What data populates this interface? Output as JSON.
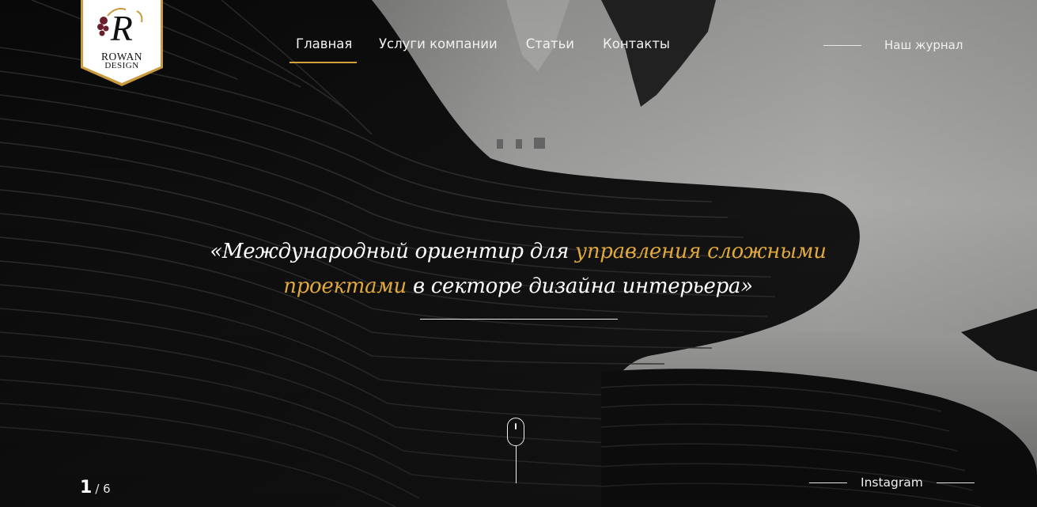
{
  "logo": {
    "line1": "ROWAN",
    "line2": "DESIGN",
    "monogram": "R",
    "colors": {
      "badge": "#ffffff",
      "border": "#c99a3e",
      "text": "#111111"
    }
  },
  "nav": {
    "items": [
      {
        "label": "Главная",
        "active": true
      },
      {
        "label": "Услуги компании",
        "active": false
      },
      {
        "label": "Статьи",
        "active": false
      },
      {
        "label": "Контакты",
        "active": false
      }
    ],
    "active_color": "#d4a13a"
  },
  "journal": {
    "label": "Наш журнал"
  },
  "hero": {
    "quote_open": "«",
    "quote_part1": "Международный ориентир для ",
    "quote_highlight": "управления сложными проектами",
    "quote_part2": " в секторе дизайна интерьера",
    "quote_close": "»",
    "highlight_color": "#e0a83a"
  },
  "slider": {
    "current": "1",
    "total": "/ 6"
  },
  "instagram": {
    "label": "Instagram"
  },
  "icons": {
    "scroll": "mouse-scroll-icon"
  }
}
